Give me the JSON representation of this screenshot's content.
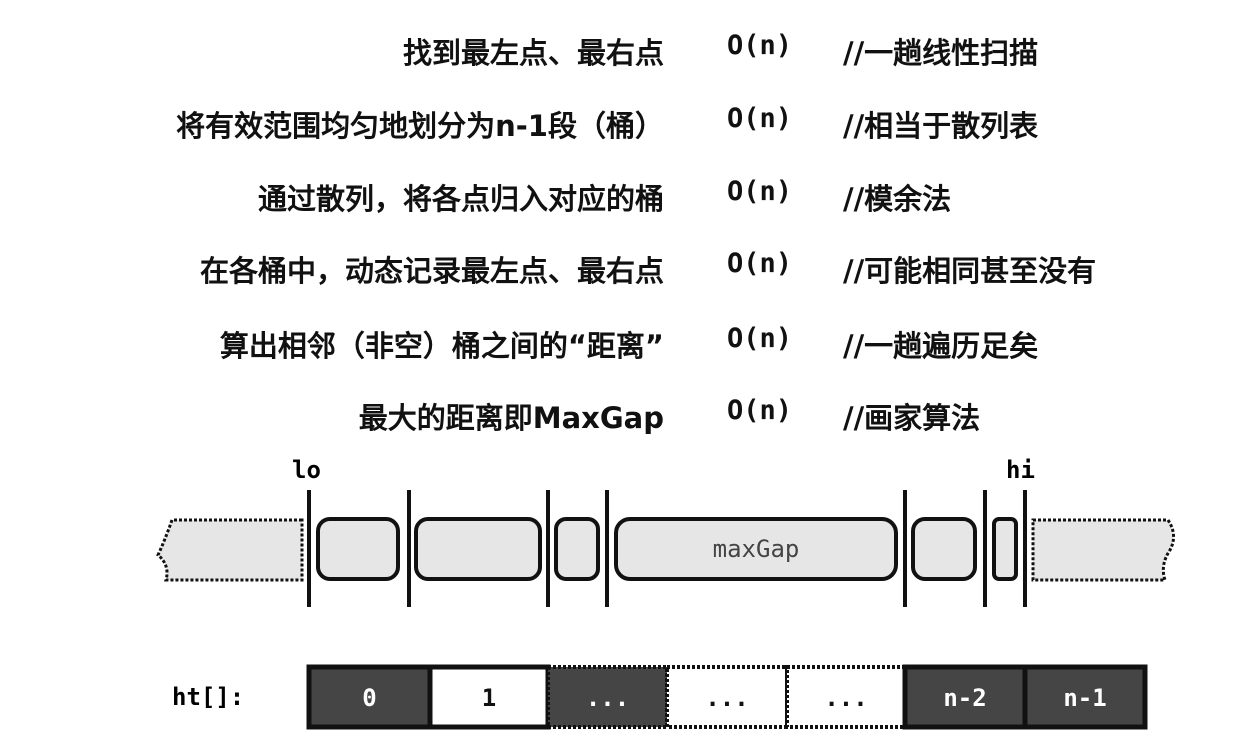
{
  "steps": [
    {
      "text": "找到最左点、最右点",
      "complexity": "O(n)",
      "comment": "//一趟线性扫描"
    },
    {
      "text": "将有效范围均匀地划分为n-1段（桶）",
      "complexity": "O(n)",
      "comment": "//相当于散列表"
    },
    {
      "text": "通过散列，将各点归入对应的桶",
      "complexity": "O(n)",
      "comment": "//模余法"
    },
    {
      "text": "在各桶中，动态记录最左点、最右点",
      "complexity": "O(n)",
      "comment": "//可能相同甚至没有"
    },
    {
      "text": "算出相邻（非空）桶之间的“距离”",
      "complexity": "O(n)",
      "comment": "//一趟遍历足矣"
    },
    {
      "text": "最大的距离即MaxGap",
      "complexity": "O(n)",
      "comment": "//画家算法"
    }
  ],
  "diagram": {
    "lo_label": "lo",
    "hi_label": "hi",
    "gap_label": "maxGap",
    "array_label": "ht[]:",
    "cells": [
      {
        "label": "0",
        "style": "dark"
      },
      {
        "label": "1",
        "style": "light"
      },
      {
        "label": "...",
        "style": "dark-dotted"
      },
      {
        "label": "...",
        "style": "light-dotted"
      },
      {
        "label": "...",
        "style": "light-dotted"
      },
      {
        "label": "n-2",
        "style": "dark"
      },
      {
        "label": "n-1",
        "style": "dark"
      }
    ]
  }
}
